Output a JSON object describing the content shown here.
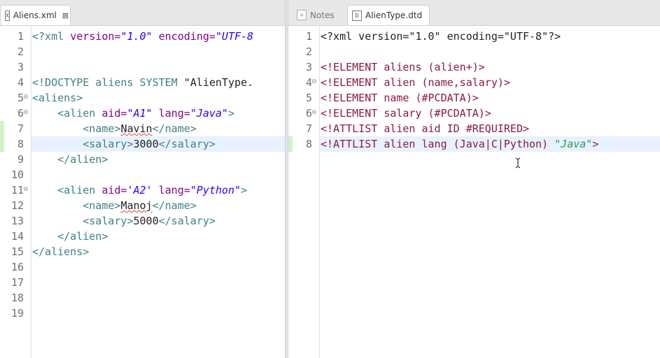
{
  "left_tab": {
    "label": "Aliens.xml",
    "icon": "xml-file-icon"
  },
  "right_tabs": [
    {
      "label": "Notes"
    },
    {
      "label": "AlienType.dtd",
      "icon": "dtd-file-icon"
    }
  ],
  "left_editor": {
    "line_numbers": [
      "1",
      "2",
      "3",
      "4",
      "5",
      "6",
      "7",
      "8",
      "9",
      "10",
      "11",
      "12",
      "13",
      "14",
      "15",
      "16",
      "17",
      "18",
      "19"
    ],
    "line1_a": "<?xml ",
    "line1_b": "version=",
    "line1_c": "\"1.0\"",
    "line1_d": " encoding=",
    "line1_e": "\"UTF-8",
    "line4_a": "<!DOCTYPE aliens SYSTEM ",
    "line4_b": "\"AlienType.",
    "line5_a": "<aliens>",
    "line6_a": "    <alien ",
    "line6_b": "aid=",
    "line6_c": "\"A1\"",
    "line6_d": " lang=",
    "line6_e": "\"Java\"",
    "line6_f": ">",
    "line7_a": "        <name>",
    "line7_b": "Navin",
    "line7_c": "</name>",
    "line8_a": "        <salary>",
    "line8_b": "3000",
    "line8_c": "</salary>",
    "line9_a": "    </alien>",
    "line11_a": "    <alien ",
    "line11_b": "aid=",
    "line11_c": "'A2'",
    "line11_d": " lang=",
    "line11_e": "\"Python\"",
    "line11_f": ">",
    "line12_a": "        <name>",
    "line12_b": "Manoj",
    "line12_c": "</name>",
    "line13_a": "        <salary>",
    "line13_b": "5000",
    "line13_c": "</salary>",
    "line14_a": "    </alien>",
    "line15_a": "</aliens>"
  },
  "right_editor": {
    "line_numbers": [
      "1",
      "2",
      "3",
      "4",
      "5",
      "6",
      "7",
      "8"
    ],
    "line1": "<?xml version=\"1.0\" encoding=\"UTF-8\"?>",
    "line3_a": "<!ELEMENT ",
    "line3_b": "aliens ",
    "line3_c": "(alien+)",
    "line3_d": ">",
    "line4_a": "<!ELEMENT ",
    "line4_b": "alien ",
    "line4_c": "(name,salary)",
    "line4_d": ">",
    "line5_a": "<!ELEMENT ",
    "line5_b": "name ",
    "line5_c": "(#PCDATA)",
    "line5_d": ">",
    "line6_a": "<!ELEMENT ",
    "line6_b": "salary ",
    "line6_c": "(#PCDATA)",
    "line6_d": ">",
    "line7_a": "<!ATTLIST ",
    "line7_b": "alien aid ID ",
    "line7_c": "#REQUIRED",
    "line7_d": ">",
    "line8_a": "<!ATTLIST ",
    "line8_b": "alien lang ",
    "line8_c": "(Java|C|Python)",
    "line8_d": " ",
    "line8_e": "\"Java\"",
    "line8_f": ">"
  },
  "colors": {
    "tag": "#3f7f7f",
    "attribute": "#7f007f",
    "value": "#2a00ff",
    "dtd_keyword": "#8b1a3f",
    "default_value": "#2f9a4a",
    "current_line": "#e8f2fe"
  }
}
